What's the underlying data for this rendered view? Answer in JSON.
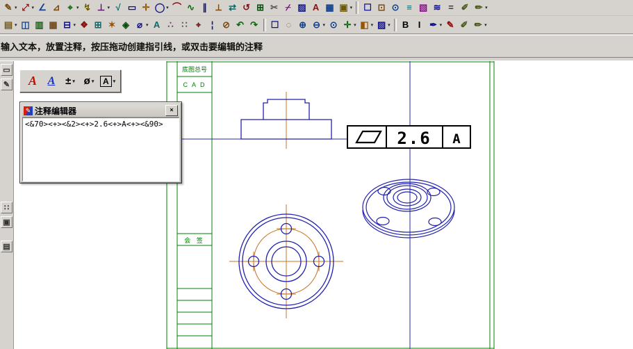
{
  "app": {
    "type": "cad-annotation-editing"
  },
  "colors": {
    "toolbar_bg": "#d6d3ce",
    "canvas_bg": "#ffffff",
    "geometry_blue": "#2020b0",
    "sheet_frame_green": "#008000",
    "centerline_orange": "#c87020",
    "gdt_black": "#000000"
  },
  "prompt": {
    "text": "输入文本，放置注释，按压拖动创建指引线，或双击要编辑的注释"
  },
  "dialog": {
    "title": "注释编辑器",
    "icon_glyph": "✎",
    "close_label": "×",
    "content": "<&70><+><&2><+>2.6<+>A<+><&90>"
  },
  "gdt": {
    "symbol": "flatness-parallelogram",
    "value": "2.6",
    "datum": "A"
  },
  "sheet": {
    "label_top": "底图总号",
    "label_cad": "C A D",
    "label_countersign": "会 签"
  },
  "annotation_toolbar": {
    "items": [
      {
        "name": "text-compose-tool",
        "glyph": "A"
      },
      {
        "name": "text-edit-tool",
        "glyph": "A"
      },
      {
        "name": "insert-plusminus-tool",
        "glyph": "±"
      },
      {
        "name": "insert-diameter-tool",
        "glyph": "ø"
      },
      {
        "name": "insert-boxed-text-tool",
        "glyph": "A"
      }
    ],
    "dropdown_glyph": "▾"
  },
  "toolbar_row1": [
    {
      "name": "pencil-dimension-icon",
      "glyph": "✎",
      "color": "#7a4a12",
      "dd": true
    },
    {
      "name": "smart-dimension-icon",
      "glyph": "⤢",
      "color": "#8a1010",
      "dd": true
    },
    {
      "name": "angle-dimension-icon",
      "glyph": "∠",
      "color": "#10408a"
    },
    {
      "name": "chamfer-dimension-icon",
      "glyph": "⊿",
      "color": "#7a4a12"
    },
    {
      "name": "coordinate-dimension-icon",
      "glyph": "⌖",
      "color": "#0a6a0a",
      "dd": true
    },
    {
      "name": "leader-annotation-icon",
      "glyph": "↯",
      "color": "#6a5a00"
    },
    {
      "name": "datum-symbol-icon",
      "glyph": "⊥",
      "color": "#5a0a6a",
      "dd": true
    },
    {
      "name": "roughness-symbol-icon",
      "glyph": "√",
      "color": "#0a6a6a"
    },
    {
      "name": "tolerance-frame-icon",
      "glyph": "▭",
      "color": "#10108a"
    },
    {
      "name": "center-mark-icon",
      "glyph": "✛",
      "color": "#9a5500"
    },
    {
      "name": "circle-tool-icon",
      "glyph": "◯",
      "color": "#10108a",
      "dd": true
    },
    {
      "name": "arc-tool-icon",
      "glyph": "⌒",
      "color": "#8a1010"
    },
    {
      "name": "spline-tool-icon",
      "glyph": "∿",
      "color": "#0a6a0a"
    },
    {
      "name": "parallel-line-icon",
      "glyph": "∥",
      "color": "#10108a"
    },
    {
      "name": "perpendicular-line-icon",
      "glyph": "⟂",
      "color": "#7a4a12"
    },
    {
      "name": "mirror-tool-icon",
      "glyph": "⇄",
      "color": "#0a6a6a"
    },
    {
      "name": "rotate-tool-icon",
      "glyph": "↺",
      "color": "#8a1010"
    },
    {
      "name": "array-tool-icon",
      "glyph": "⊞",
      "color": "#0a4a0a"
    },
    {
      "name": "trim-tool-icon",
      "glyph": "✂",
      "color": "#555555"
    },
    {
      "name": "break-tool-icon",
      "glyph": "⌿",
      "color": "#6a0a6a"
    },
    {
      "name": "hatch-tool-icon",
      "glyph": "▨",
      "color": "#10108a"
    },
    {
      "name": "text-tool-icon",
      "glyph": "A",
      "color": "#8a1010"
    },
    {
      "name": "table-tool-icon",
      "glyph": "▦",
      "color": "#10408a"
    },
    {
      "name": "block-tool-icon",
      "glyph": "▣",
      "color": "#6a5a00",
      "dd": true
    },
    {
      "sep": true
    },
    {
      "name": "select-window-icon",
      "glyph": "☐",
      "color": "#10108a"
    },
    {
      "name": "zoom-window-icon",
      "glyph": "⊡",
      "color": "#7a4a12"
    },
    {
      "name": "zoom-all-icon",
      "glyph": "⊙",
      "color": "#10408a"
    },
    {
      "name": "layers-icon",
      "glyph": "≡",
      "color": "#0a6a6a"
    },
    {
      "name": "color-swatch-icon",
      "glyph": "▧",
      "color": "#8a108a"
    },
    {
      "name": "linetype-icon",
      "glyph": "≋",
      "color": "#10108a"
    },
    {
      "name": "linewidth-icon",
      "glyph": "=",
      "color": "#333333"
    },
    {
      "name": "pen-style-icon",
      "glyph": "✐",
      "color": "#4a5a1a"
    },
    {
      "name": "pen-style-alt-icon",
      "glyph": "✏",
      "color": "#4a5a1a",
      "dd": true
    }
  ],
  "toolbar_row2": [
    {
      "name": "open-sheet-icon",
      "glyph": "▤",
      "color": "#7a5a10",
      "dd": true
    },
    {
      "name": "frame-settings-icon",
      "glyph": "◫",
      "color": "#10408a"
    },
    {
      "name": "title-block-icon",
      "glyph": "▥",
      "color": "#0a6a0a"
    },
    {
      "name": "parts-list-icon",
      "glyph": "▦",
      "color": "#7a4a12"
    },
    {
      "name": "bom-table-icon",
      "glyph": "⊟",
      "color": "#10108a",
      "dd": true
    },
    {
      "name": "symbol-library-icon",
      "glyph": "❖",
      "color": "#8a1010"
    },
    {
      "name": "insert-block-icon",
      "glyph": "⊞",
      "color": "#0a6a6a"
    },
    {
      "name": "explode-icon",
      "glyph": "✶",
      "color": "#9a5500"
    },
    {
      "name": "group-icon",
      "glyph": "◈",
      "color": "#0a4a0a"
    },
    {
      "name": "dimension-style-icon",
      "glyph": "⌀",
      "color": "#10108a",
      "dd": true
    },
    {
      "name": "text-style-icon",
      "glyph": "A",
      "color": "#0a6a6a"
    },
    {
      "name": "point-style-icon",
      "glyph": "∴",
      "color": "#6a3a6a"
    },
    {
      "name": "grid-toggle-icon",
      "glyph": "∷",
      "color": "#555555"
    },
    {
      "name": "snap-toggle-icon",
      "glyph": "⌖",
      "color": "#8a1010"
    },
    {
      "name": "ortho-toggle-icon",
      "glyph": "¦",
      "color": "#10108a"
    },
    {
      "name": "erase-tool-icon",
      "glyph": "⊘",
      "color": "#7a4a12"
    },
    {
      "name": "undo-icon",
      "glyph": "↶",
      "color": "#0a6a0a"
    },
    {
      "name": "redo-icon",
      "glyph": "↷",
      "color": "#0a6a0a"
    },
    {
      "sep": true
    },
    {
      "name": "select-filter-icon",
      "glyph": "☐",
      "color": "#10108a"
    },
    {
      "name": "pick-box-icon",
      "glyph": "◌",
      "color": "#7a4a12"
    },
    {
      "name": "zoom-in-icon",
      "glyph": "⊕",
      "color": "#10408a"
    },
    {
      "name": "zoom-out-icon",
      "glyph": "⊖",
      "color": "#10408a",
      "dd": true
    },
    {
      "name": "zoom-extents-icon",
      "glyph": "⊙",
      "color": "#10408a"
    },
    {
      "name": "pan-icon",
      "glyph": "✛",
      "color": "#0a6a0a",
      "dd": true
    },
    {
      "name": "fill-color-icon",
      "glyph": "◧",
      "color": "#9a5500",
      "dd": true
    },
    {
      "name": "outline-color-icon",
      "glyph": "▨",
      "color": "#10108a",
      "dd": true
    },
    {
      "sep": true
    },
    {
      "name": "bold-icon",
      "glyph": "B",
      "color": "#000000"
    },
    {
      "name": "italic-icon",
      "glyph": "I",
      "color": "#000000"
    },
    {
      "name": "ink-color-icon",
      "glyph": "✒",
      "color": "#10108a",
      "dd": true
    },
    {
      "name": "highlight-pen-icon",
      "glyph": "✎",
      "color": "#8a1010"
    },
    {
      "name": "brush-icon",
      "glyph": "✐",
      "color": "#4a5a1a"
    },
    {
      "name": "eyedropper-icon",
      "glyph": "✏",
      "color": "#4a5a1a",
      "dd": true
    }
  ],
  "left_toolbar": [
    {
      "name": "side-select-tool-icon",
      "glyph": "▭",
      "mt": 4
    },
    {
      "name": "side-text-tool-icon",
      "glyph": "✎",
      "mt": 4
    },
    {
      "name": "side-grid-tool-icon",
      "glyph": "∷",
      "mt": 160
    },
    {
      "name": "side-block-tool-icon",
      "glyph": "▣",
      "mt": 4
    },
    {
      "name": "side-sheet-tool-icon",
      "glyph": "▤",
      "mt": 18
    }
  ]
}
